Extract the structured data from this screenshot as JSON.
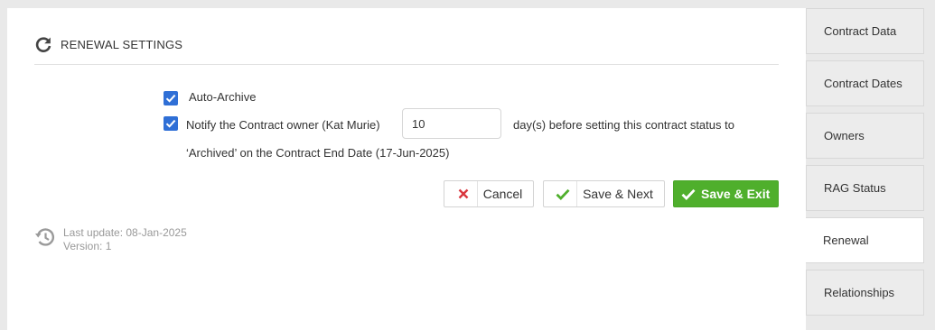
{
  "section": {
    "title": "RENEWAL SETTINGS",
    "icon": "refresh-icon"
  },
  "auto_archive": {
    "checked": true,
    "label": "Auto-Archive"
  },
  "notify": {
    "checked": true,
    "label_prefix": "Notify the Contract owner (Kat Murie)",
    "days_value": "10",
    "label_suffix": "day(s) before setting this contract status to",
    "label_line2": "‘Archived’ on the Contract End Date (17-Jun-2025)"
  },
  "buttons": {
    "cancel": "Cancel",
    "save_next": "Save & Next",
    "save_exit": "Save & Exit"
  },
  "meta": {
    "last_update": "Last update: 08-Jan-2025",
    "version": "Version: 1"
  },
  "sidebar": {
    "items": [
      {
        "label": "Contract Data",
        "active": false
      },
      {
        "label": "Contract Dates",
        "active": false
      },
      {
        "label": "Owners",
        "active": false
      },
      {
        "label": "RAG Status",
        "active": false
      },
      {
        "label": "Renewal",
        "active": true
      },
      {
        "label": "Relationships",
        "active": false
      }
    ]
  },
  "colors": {
    "accent_blue": "#2f6fd6",
    "save_green": "#4faf2c",
    "cancel_red": "#d9363e",
    "check_green": "#4faf2c"
  }
}
